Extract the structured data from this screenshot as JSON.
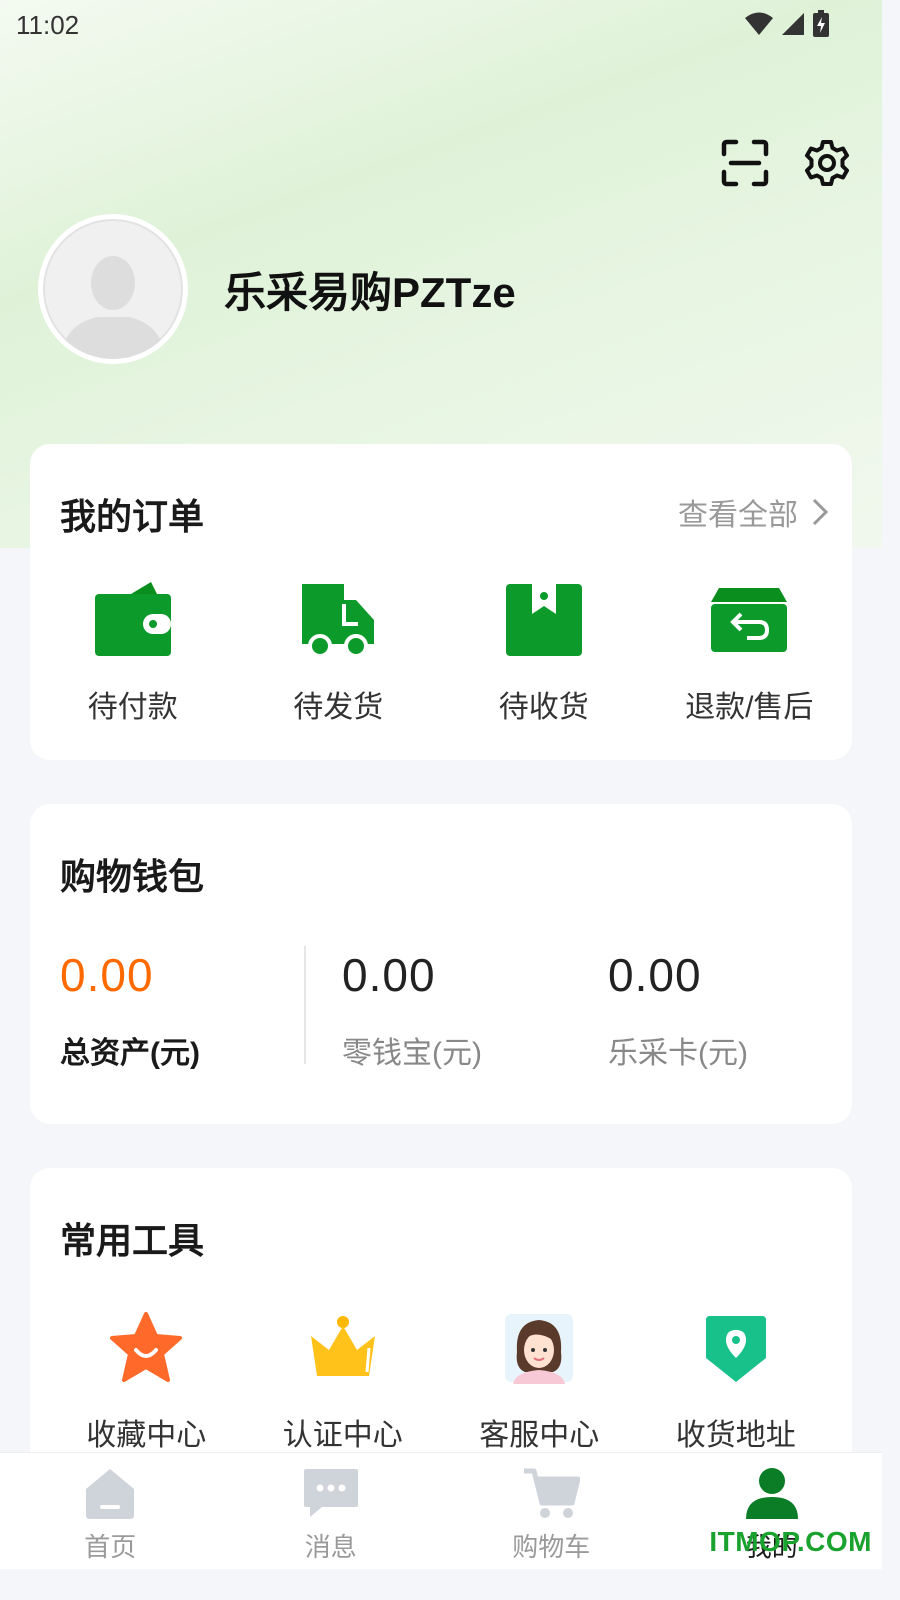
{
  "status_bar": {
    "time": "11:02"
  },
  "profile": {
    "username": "乐采易购PZTze"
  },
  "orders": {
    "title": "我的订单",
    "view_all": "查看全部",
    "items": [
      {
        "label": "待付款",
        "icon": "wallet-icon"
      },
      {
        "label": "待发货",
        "icon": "truck-icon"
      },
      {
        "label": "待收货",
        "icon": "package-icon"
      },
      {
        "label": "退款/售后",
        "icon": "return-box-icon"
      }
    ]
  },
  "wallet": {
    "title": "购物钱包",
    "stats": [
      {
        "value": "0.00",
        "label": "总资产(元)"
      },
      {
        "value": "0.00",
        "label": "零钱宝(元)"
      },
      {
        "value": "0.00",
        "label": "乐采卡(元)"
      }
    ]
  },
  "tools": {
    "title": "常用工具",
    "items": [
      {
        "label": "收藏中心",
        "icon": "star-icon"
      },
      {
        "label": "认证中心",
        "icon": "crown-icon"
      },
      {
        "label": "客服中心",
        "icon": "customer-service-avatar-icon"
      },
      {
        "label": "收货地址",
        "icon": "location-pin-icon"
      }
    ]
  },
  "tab_bar": {
    "items": [
      {
        "label": "首页",
        "icon": "home-icon"
      },
      {
        "label": "消息",
        "icon": "message-icon"
      },
      {
        "label": "购物车",
        "icon": "cart-icon"
      },
      {
        "label": "我的",
        "icon": "user-icon",
        "active": true
      }
    ]
  },
  "watermark": "ITMOP.COM",
  "colors": {
    "accent_green": "#0c9a2b",
    "highlight_orange": "#ff6a00",
    "inactive_gray": "#cfd3da"
  }
}
